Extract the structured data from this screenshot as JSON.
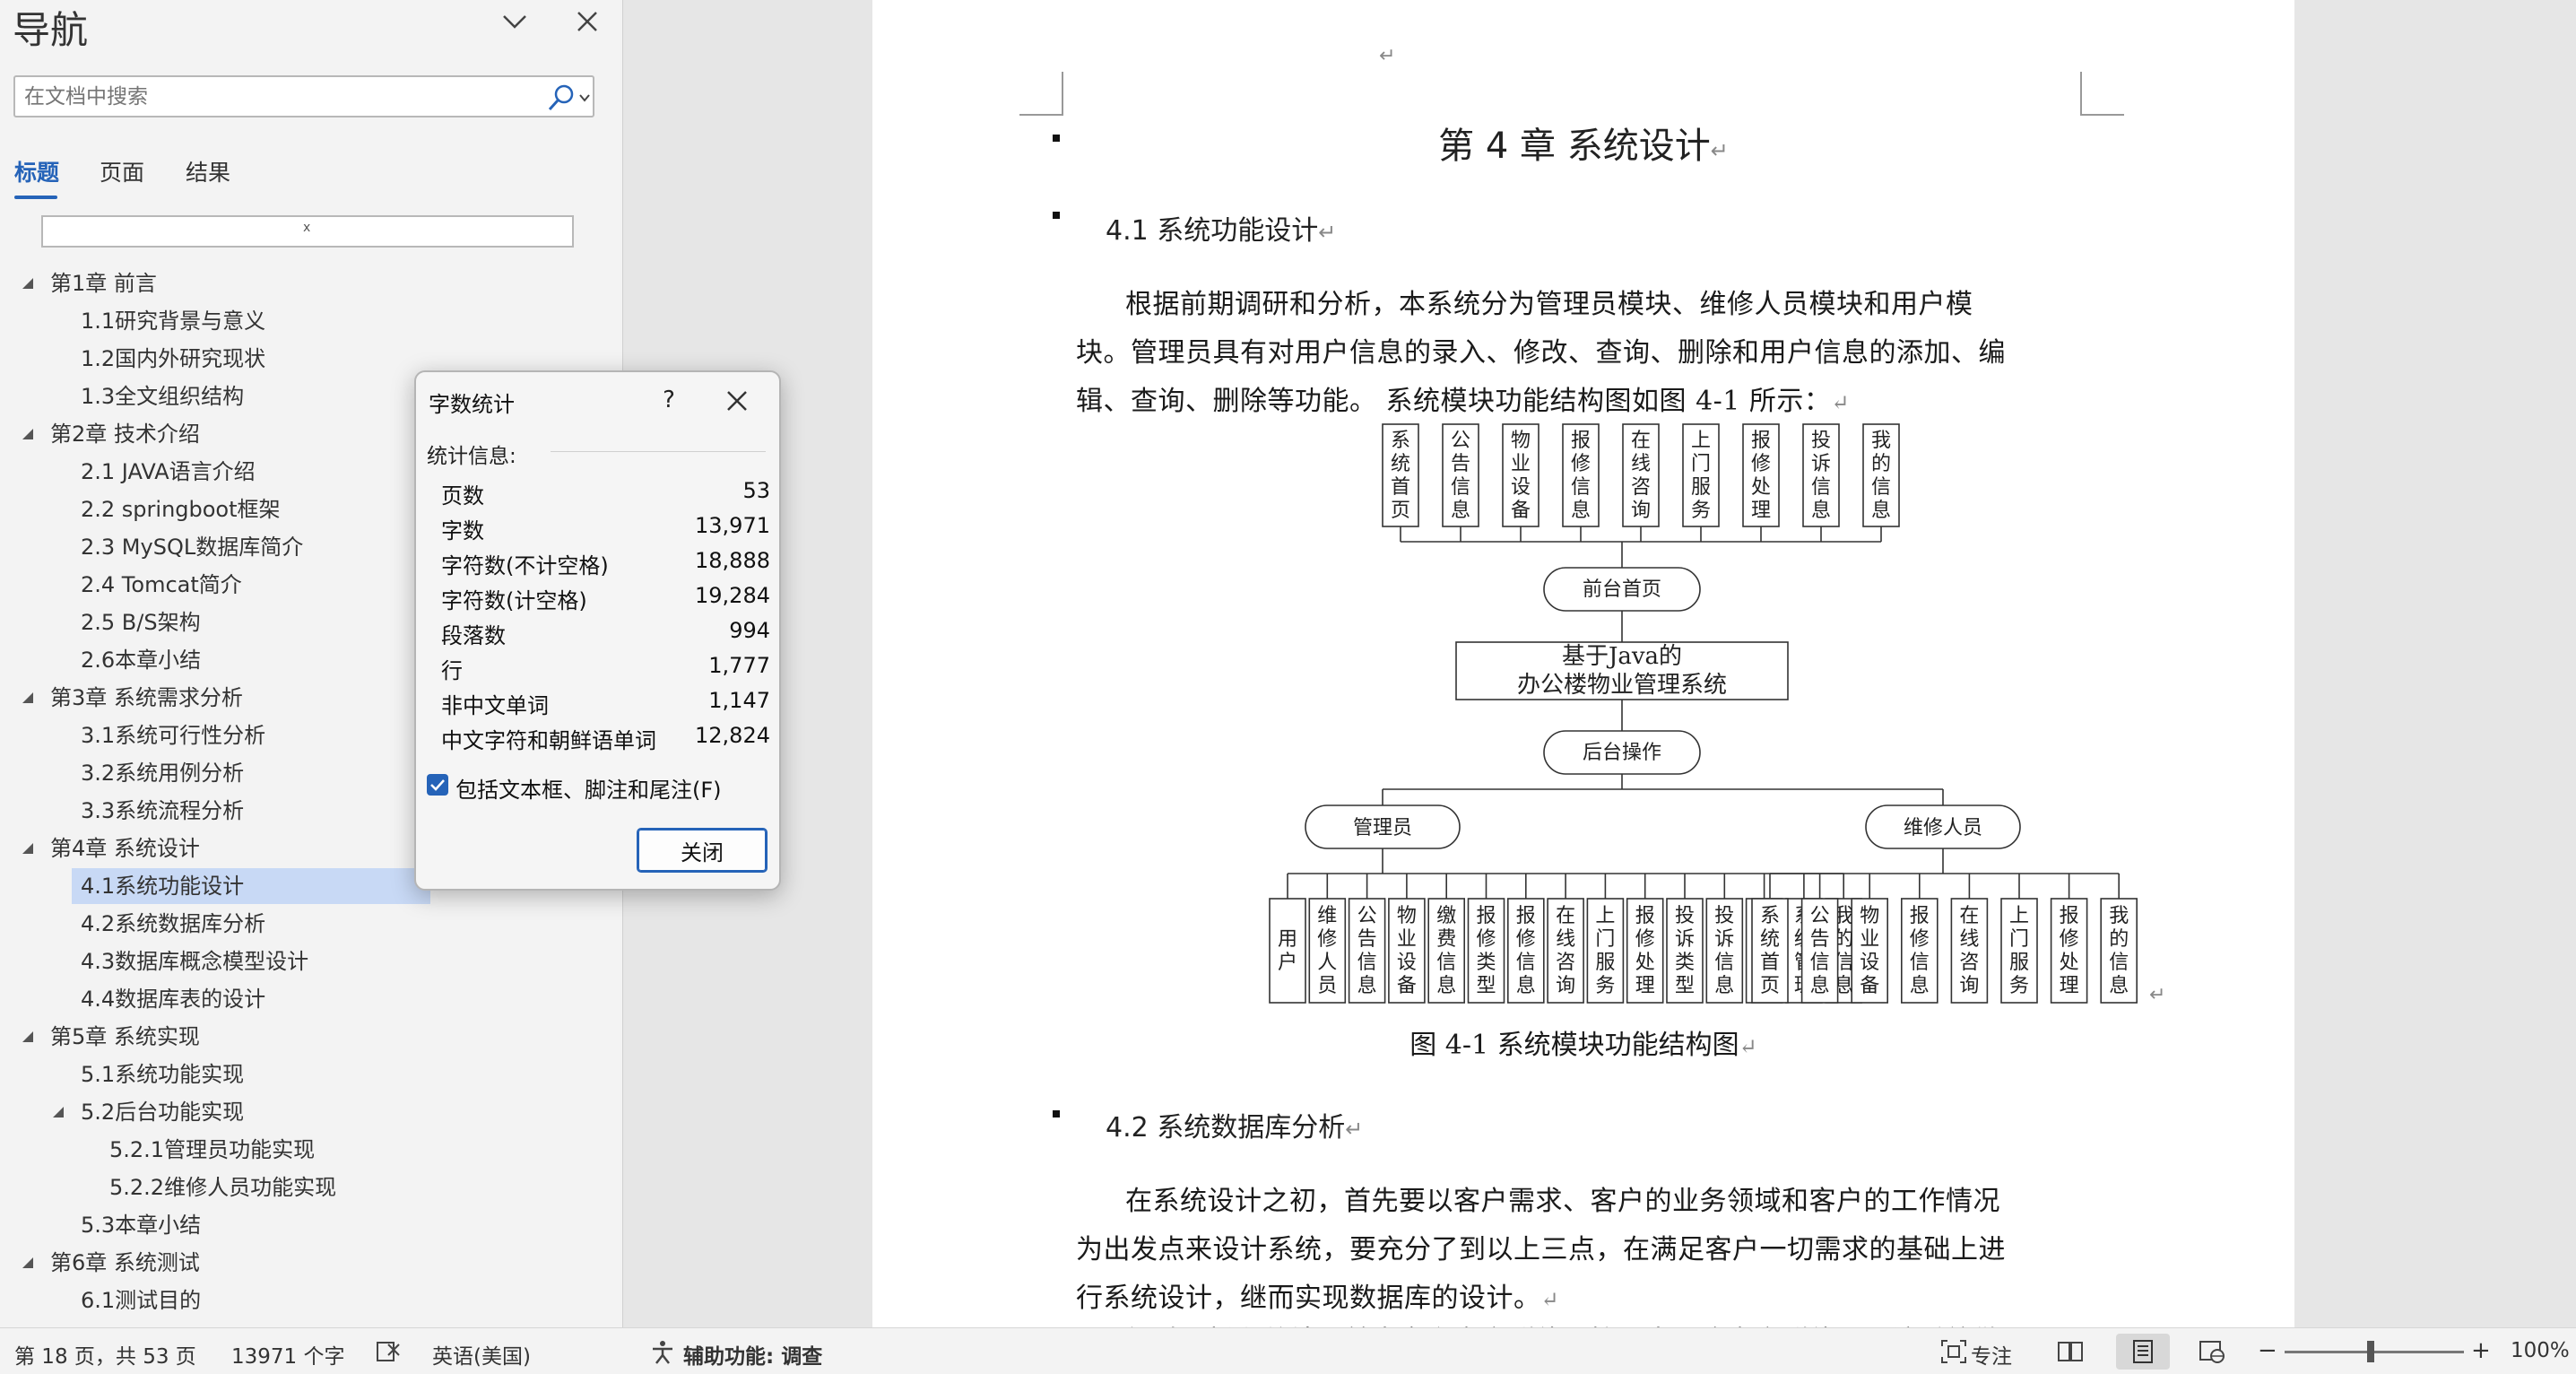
{
  "nav": {
    "title": "导航",
    "search_placeholder": "在文档中搜索",
    "tabs": [
      "标题",
      "页面",
      "结果"
    ],
    "resize_glyph": "ⅹ",
    "tree": [
      {
        "label": "第1章 前言",
        "level": 0,
        "expanded": true
      },
      {
        "label": "1.1研究背景与意义",
        "level": 1
      },
      {
        "label": "1.2国内外研究现状",
        "level": 1
      },
      {
        "label": "1.3全文组织结构",
        "level": 1
      },
      {
        "label": "第2章 技术介绍",
        "level": 0,
        "expanded": true
      },
      {
        "label": "2.1 JAVA语言介绍",
        "level": 1
      },
      {
        "label": "2.2 springboot框架",
        "level": 1
      },
      {
        "label": "2.3 MySQL数据库简介",
        "level": 1
      },
      {
        "label": "2.4 Tomcat简介",
        "level": 1
      },
      {
        "label": "2.5 B/S架构",
        "level": 1
      },
      {
        "label": "2.6本章小结",
        "level": 1
      },
      {
        "label": "第3章 系统需求分析",
        "level": 0,
        "expanded": true
      },
      {
        "label": "3.1系统可行性分析",
        "level": 1
      },
      {
        "label": "3.2系统用例分析",
        "level": 1
      },
      {
        "label": "3.3系统流程分析",
        "level": 1
      },
      {
        "label": "第4章 系统设计",
        "level": 0,
        "expanded": true
      },
      {
        "label": "4.1系统功能设计",
        "level": 1,
        "selected": true
      },
      {
        "label": "4.2系统数据库分析",
        "level": 1
      },
      {
        "label": "4.3数据库概念模型设计",
        "level": 1
      },
      {
        "label": "4.4数据库表的设计",
        "level": 1
      },
      {
        "label": "第5章 系统实现",
        "level": 0,
        "expanded": true
      },
      {
        "label": "5.1系统功能实现",
        "level": 1
      },
      {
        "label": "5.2后台功能实现",
        "level": 1,
        "expanded": true
      },
      {
        "label": "5.2.1管理员功能实现",
        "level": 2
      },
      {
        "label": "5.2.2维修人员功能实现",
        "level": 2
      },
      {
        "label": "5.3本章小结",
        "level": 1
      },
      {
        "label": "第6章 系统测试",
        "level": 0,
        "expanded": true
      },
      {
        "label": "6.1测试目的",
        "level": 1
      }
    ]
  },
  "dialog": {
    "title": "字数统计",
    "help": "?",
    "section_label": "统计信息:",
    "stats": [
      {
        "label": "页数",
        "value": "53"
      },
      {
        "label": "字数",
        "value": "13,971"
      },
      {
        "label": "字符数(不计空格)",
        "value": "18,888"
      },
      {
        "label": "字符数(计空格)",
        "value": "19,284"
      },
      {
        "label": "段落数",
        "value": "994"
      },
      {
        "label": "行",
        "value": "1,777"
      },
      {
        "label": "非中文单词",
        "value": "1,147"
      },
      {
        "label": "中文字符和朝鲜语单词",
        "value": "12,824"
      }
    ],
    "checkbox_label": "包括文本框、脚注和尾注(F)",
    "checkbox_checked": true,
    "close_button": "关闭"
  },
  "document": {
    "return_mark": "↵",
    "chapter_title": "第 4 章  系统设计",
    "section_41": "4.1 系统功能设计",
    "para1": [
      "根据前期调研和分析，本系统分为管理员模块、维修人员模块和用户模",
      "块。管理员具有对用户信息的录入、修改、查询、删除和用户信息的添加、编",
      "辑、查询、删除等功能。  系统模块功能结构图如图 4-1 所示："
    ],
    "diagram": {
      "top_boxes": [
        "系统首页",
        "公告信息",
        "物业设备",
        "报修信息",
        "在线咨询",
        "上门服务",
        "报修处理",
        "投诉信息",
        "我的信息"
      ],
      "front_node": "前台首页",
      "root_node": [
        "基于Java的",
        "办公楼物业管理系统"
      ],
      "back_node": "后台操作",
      "admin_node": "管理员",
      "repair_node": "维修人员",
      "admin_boxes": [
        "用户",
        "维修人员",
        "公告信息",
        "物业设备",
        "缴费信息",
        "报修类型",
        "报修信息",
        "在线咨询",
        "上门服务",
        "报修处理",
        "投诉类型",
        "投诉信息",
        "管理员",
        "系统管理",
        "我的信息"
      ],
      "repair_boxes": [
        "系统首页",
        "公告信息",
        "物业设备",
        "报修信息",
        "在线咨询",
        "上门服务",
        "报修处理",
        "我的信息"
      ]
    },
    "figure_caption": "图 4-1  系统模块功能结构图",
    "section_42": "4.2 系统数据库分析",
    "para2": [
      "在系统设计之初，首先要以客户需求、客户的业务领域和客户的工作情况",
      "为出发点来设计系统，要充分了到以上三点，在满足客户一切需求的基础上进",
      "行系统设计，继而实现数据库的设计。"
    ],
    "para3_partial": "经过分析和总结，首先定义客户群体，接下来明确客户群体要用该系统做"
  },
  "status": {
    "page_info": "第 18 页，共 53 页",
    "word_count": "13971 个字",
    "language": "英语(美国)",
    "accessibility": "辅助功能: 调查",
    "focus": "专注",
    "zoom": "100%"
  },
  "colors": {
    "accent": "#2563b8",
    "selection": "#c8d9f5"
  }
}
